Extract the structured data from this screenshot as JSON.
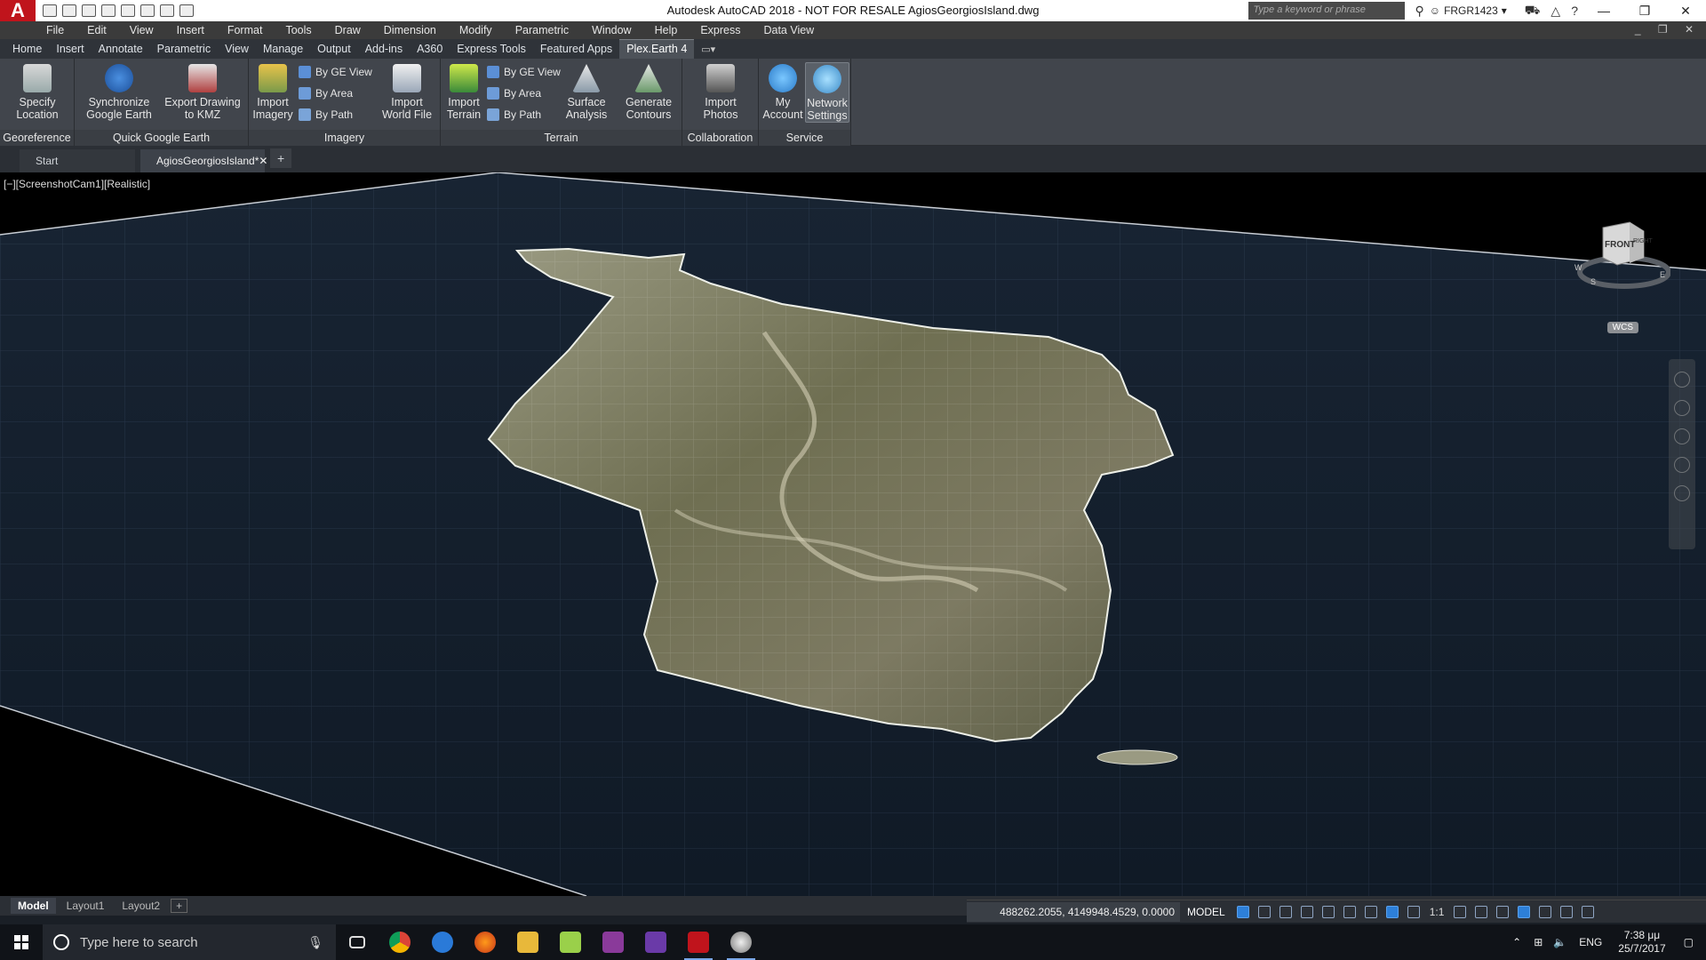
{
  "titlebar": {
    "logo": "A",
    "title": "Autodesk AutoCAD 2018 - NOT FOR RESALE    AgiosGeorgiosIsland.dwg",
    "search_placeholder": "Type a keyword or phrase",
    "user": "FRGR1423",
    "minimize": "—",
    "restore": "❐",
    "close": "✕"
  },
  "menubar": {
    "items": [
      "File",
      "Edit",
      "View",
      "Insert",
      "Format",
      "Tools",
      "Draw",
      "Dimension",
      "Modify",
      "Parametric",
      "Window",
      "Help",
      "Express",
      "Data View"
    ],
    "right_controls": "_ ❐ ✕"
  },
  "ribbon_tabs": {
    "items": [
      "Home",
      "Insert",
      "Annotate",
      "Parametric",
      "View",
      "Manage",
      "Output",
      "Add-ins",
      "A360",
      "Express Tools",
      "Featured Apps",
      "Plex.Earth 4"
    ],
    "active": "Plex.Earth 4",
    "extra": "▭▾"
  },
  "ribbon": {
    "panels": {
      "georeference": {
        "label": "Georeference",
        "specify_location": "Specify\nLocation"
      },
      "quick_google_earth": {
        "label": "Quick Google Earth",
        "synchronize": "Synchronize\nGoogle Earth",
        "export": "Export Drawing\nto KMZ"
      },
      "imagery": {
        "label": "Imagery",
        "import_imagery": "Import\nImagery",
        "by_ge_view": "By GE View",
        "by_area": "By Area",
        "by_path": "By Path",
        "import_world_file": "Import\nWorld File"
      },
      "terrain": {
        "label": "Terrain",
        "import_terrain": "Import\nTerrain",
        "by_ge_view": "By GE View",
        "by_area": "By Area",
        "by_path": "By Path",
        "surface_analysis": "Surface\nAnalysis",
        "generate_contours": "Generate\nContours"
      },
      "collaboration": {
        "label": "Collaboration",
        "import_photos": "Import\nPhotos"
      },
      "service": {
        "label": "Service",
        "my_account": "My\nAccount",
        "network_settings": "Network\nSettings"
      }
    }
  },
  "filetabs": {
    "start": "Start",
    "active": "AgiosGeorgiosIsland*",
    "close": "✕",
    "plus": "+"
  },
  "viewport": {
    "label": "[−][ScreenshotCam1][Realistic]",
    "viewcube_front": "FRONT",
    "viewcube_right": "RIGHT",
    "viewcube_s": "S",
    "viewcube_e": "E",
    "viewcube_w": "W",
    "wcs": "WCS"
  },
  "layout_tabs": {
    "items": [
      "Model",
      "Layout1",
      "Layout2"
    ],
    "active": "Model",
    "plus": "+"
  },
  "statusbar": {
    "coordinates": "488262.2055, 4149948.4529, 0.0000",
    "model": "MODEL",
    "scale": "1:1"
  },
  "taskbar": {
    "search_placeholder": "Type here to search",
    "language": "ENG",
    "time": "7:38 μμ",
    "date": "25/7/2017"
  },
  "colors": {
    "accent": "#c0141c",
    "ribbon_bg": "#41454c",
    "tab_active": "#4d5259",
    "status_blue": "#2d7fd8"
  }
}
